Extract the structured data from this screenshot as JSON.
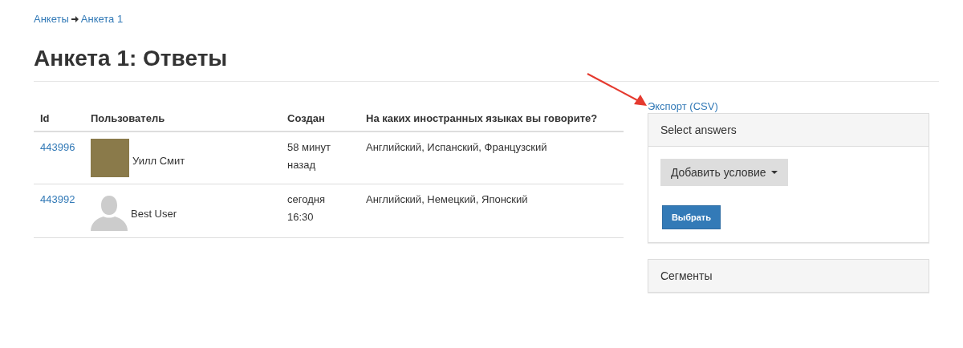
{
  "breadcrumb": [
    "Анкеты",
    "Анкета 1"
  ],
  "title": "Анкета 1: Ответы",
  "table": {
    "columns": [
      "Id",
      "Пользователь",
      "Создан",
      "На каких иностранных языках вы говорите?"
    ],
    "rows": [
      {
        "id": "443996",
        "kind": "photo",
        "user": "Уилл Смит",
        "created": "58 минут назад",
        "answer": "Английский, Испанский, Французский"
      },
      {
        "id": "443992",
        "kind": "default",
        "user": "Best User",
        "created": "сегодня 16:30",
        "answer": "Английский, Немецкий, Японский"
      }
    ]
  },
  "export_link": "Экспорт (CSV)",
  "select_panel": {
    "title": "Select answers",
    "add_button": "Добавить условие",
    "submit_button": "Выбрать"
  },
  "segments_panel": {
    "title": "Сегменты"
  }
}
